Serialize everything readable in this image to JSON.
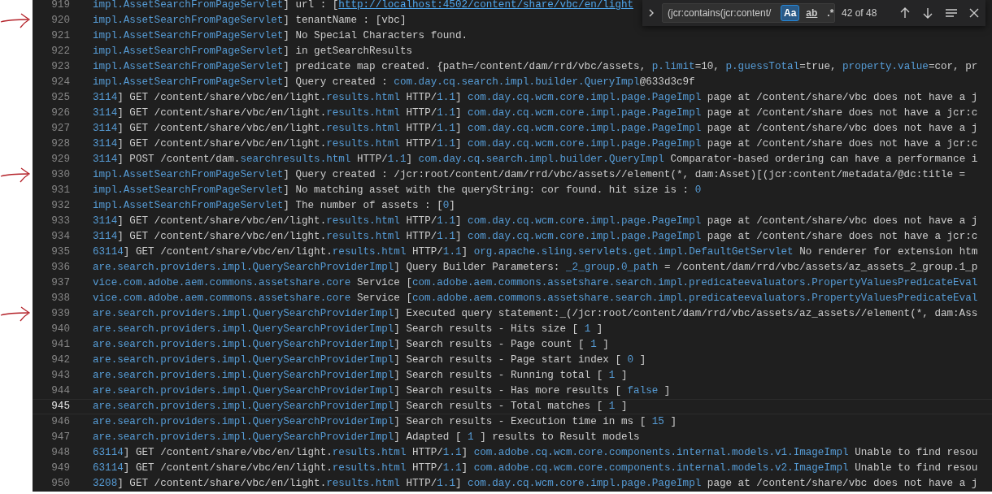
{
  "find_widget": {
    "query": "(jcr:contains(jcr:content/",
    "options": [
      {
        "label": "Aa",
        "selected": true
      },
      {
        "label": "ab",
        "selected": false
      },
      {
        "label": ".*",
        "selected": false
      }
    ],
    "result": "42 of 48"
  },
  "lines": [
    {
      "number": "919",
      "marked": false,
      "current": false,
      "segments": [
        {
          "text": "impl.AssetSearchFromPageServlet",
          "kind": "token"
        },
        {
          "text": "] url : [",
          "kind": "plain"
        },
        {
          "text": "http://localhost:4502/content/share/vbc/en/light",
          "kind": "link"
        }
      ]
    },
    {
      "number": "920",
      "marked": true,
      "current": false,
      "segments": [
        {
          "text": "impl.AssetSearchFromPageServlet",
          "kind": "token"
        },
        {
          "text": "] tenantName : [vbc]",
          "kind": "plain"
        }
      ]
    },
    {
      "number": "921",
      "marked": false,
      "current": false,
      "segments": [
        {
          "text": "impl.AssetSearchFromPageServlet",
          "kind": "token"
        },
        {
          "text": "] No Special Characters found.",
          "kind": "plain"
        }
      ]
    },
    {
      "number": "922",
      "marked": false,
      "current": false,
      "segments": [
        {
          "text": "impl.AssetSearchFromPageServlet",
          "kind": "token"
        },
        {
          "text": "] in getSearchResults",
          "kind": "plain"
        }
      ]
    },
    {
      "number": "923",
      "marked": false,
      "current": false,
      "segments": [
        {
          "text": "impl.AssetSearchFromPageServlet",
          "kind": "token"
        },
        {
          "text": "] predicate map created. {path=/content/dam/rrd/vbc/assets, ",
          "kind": "plain"
        },
        {
          "text": "p.limit",
          "kind": "token"
        },
        {
          "text": "=10, ",
          "kind": "plain"
        },
        {
          "text": "p.guessTotal",
          "kind": "token"
        },
        {
          "text": "=true, ",
          "kind": "plain"
        },
        {
          "text": "property.value",
          "kind": "token"
        },
        {
          "text": "=cor, pr",
          "kind": "plain"
        }
      ]
    },
    {
      "number": "924",
      "marked": false,
      "current": false,
      "segments": [
        {
          "text": "impl.AssetSearchFromPageServlet",
          "kind": "token"
        },
        {
          "text": "] Query created : ",
          "kind": "plain"
        },
        {
          "text": "com.day.cq.search.impl.builder.QueryImpl",
          "kind": "token"
        },
        {
          "text": "@633d3c9f",
          "kind": "plain"
        }
      ]
    },
    {
      "number": "925",
      "marked": false,
      "current": false,
      "segments": [
        {
          "text": "3114",
          "kind": "token"
        },
        {
          "text": "] GET /content/share/vbc/en/light.",
          "kind": "plain"
        },
        {
          "text": "results.html",
          "kind": "token"
        },
        {
          "text": " HTTP/",
          "kind": "plain"
        },
        {
          "text": "1.1",
          "kind": "token"
        },
        {
          "text": "] ",
          "kind": "plain"
        },
        {
          "text": "com.day.cq.wcm.core.impl.page.PageImpl",
          "kind": "token"
        },
        {
          "text": " page at /content/share/vbc does not have a j",
          "kind": "plain"
        }
      ]
    },
    {
      "number": "926",
      "marked": false,
      "current": false,
      "segments": [
        {
          "text": "3114",
          "kind": "token"
        },
        {
          "text": "] GET /content/share/vbc/en/light.",
          "kind": "plain"
        },
        {
          "text": "results.html",
          "kind": "token"
        },
        {
          "text": " HTTP/",
          "kind": "plain"
        },
        {
          "text": "1.1",
          "kind": "token"
        },
        {
          "text": "] ",
          "kind": "plain"
        },
        {
          "text": "com.day.cq.wcm.core.impl.page.PageImpl",
          "kind": "token"
        },
        {
          "text": " page at /content/share does not have a jcr:c",
          "kind": "plain"
        }
      ]
    },
    {
      "number": "927",
      "marked": false,
      "current": false,
      "segments": [
        {
          "text": "3114",
          "kind": "token"
        },
        {
          "text": "] GET /content/share/vbc/en/light.",
          "kind": "plain"
        },
        {
          "text": "results.html",
          "kind": "token"
        },
        {
          "text": " HTTP/",
          "kind": "plain"
        },
        {
          "text": "1.1",
          "kind": "token"
        },
        {
          "text": "] ",
          "kind": "plain"
        },
        {
          "text": "com.day.cq.wcm.core.impl.page.PageImpl",
          "kind": "token"
        },
        {
          "text": " page at /content/share/vbc does not have a j",
          "kind": "plain"
        }
      ]
    },
    {
      "number": "928",
      "marked": false,
      "current": false,
      "segments": [
        {
          "text": "3114",
          "kind": "token"
        },
        {
          "text": "] GET /content/share/vbc/en/light.",
          "kind": "plain"
        },
        {
          "text": "results.html",
          "kind": "token"
        },
        {
          "text": " HTTP/",
          "kind": "plain"
        },
        {
          "text": "1.1",
          "kind": "token"
        },
        {
          "text": "] ",
          "kind": "plain"
        },
        {
          "text": "com.day.cq.wcm.core.impl.page.PageImpl",
          "kind": "token"
        },
        {
          "text": " page at /content/share does not have a jcr:c",
          "kind": "plain"
        }
      ]
    },
    {
      "number": "929",
      "marked": false,
      "current": false,
      "segments": [
        {
          "text": "3114",
          "kind": "token"
        },
        {
          "text": "] POST /content/dam.",
          "kind": "plain"
        },
        {
          "text": "searchresults.html",
          "kind": "token"
        },
        {
          "text": " HTTP/",
          "kind": "plain"
        },
        {
          "text": "1.1",
          "kind": "token"
        },
        {
          "text": "] ",
          "kind": "plain"
        },
        {
          "text": "com.day.cq.search.impl.builder.QueryImpl",
          "kind": "token"
        },
        {
          "text": " Comparator-based ordering can have a performance i",
          "kind": "plain"
        }
      ]
    },
    {
      "number": "930",
      "marked": true,
      "current": false,
      "segments": [
        {
          "text": "impl.AssetSearchFromPageServlet",
          "kind": "token"
        },
        {
          "text": "] Query created : /jcr:root/content/dam/rrd/vbc/assets//element(*, dam:Asset)[(jcr:content/metadata/@dc:title =",
          "kind": "plain"
        }
      ]
    },
    {
      "number": "931",
      "marked": false,
      "current": false,
      "segments": [
        {
          "text": "impl.AssetSearchFromPageServlet",
          "kind": "token"
        },
        {
          "text": "] No matching asset with the queryString: cor found. hit size is : ",
          "kind": "plain"
        },
        {
          "text": "0",
          "kind": "token"
        }
      ]
    },
    {
      "number": "932",
      "marked": false,
      "current": false,
      "segments": [
        {
          "text": "impl.AssetSearchFromPageServlet",
          "kind": "token"
        },
        {
          "text": "] The number of assets : [",
          "kind": "plain"
        },
        {
          "text": "0",
          "kind": "token"
        },
        {
          "text": "]",
          "kind": "plain"
        }
      ]
    },
    {
      "number": "933",
      "marked": false,
      "current": false,
      "segments": [
        {
          "text": "3114",
          "kind": "token"
        },
        {
          "text": "] GET /content/share/vbc/en/light.",
          "kind": "plain"
        },
        {
          "text": "results.html",
          "kind": "token"
        },
        {
          "text": " HTTP/",
          "kind": "plain"
        },
        {
          "text": "1.1",
          "kind": "token"
        },
        {
          "text": "] ",
          "kind": "plain"
        },
        {
          "text": "com.day.cq.wcm.core.impl.page.PageImpl",
          "kind": "token"
        },
        {
          "text": " page at /content/share/vbc does not have a j",
          "kind": "plain"
        }
      ]
    },
    {
      "number": "934",
      "marked": false,
      "current": false,
      "segments": [
        {
          "text": "3114",
          "kind": "token"
        },
        {
          "text": "] GET /content/share/vbc/en/light.",
          "kind": "plain"
        },
        {
          "text": "results.html",
          "kind": "token"
        },
        {
          "text": " HTTP/",
          "kind": "plain"
        },
        {
          "text": "1.1",
          "kind": "token"
        },
        {
          "text": "] ",
          "kind": "plain"
        },
        {
          "text": "com.day.cq.wcm.core.impl.page.PageImpl",
          "kind": "token"
        },
        {
          "text": " page at /content/share does not have a jcr:c",
          "kind": "plain"
        }
      ]
    },
    {
      "number": "935",
      "marked": false,
      "current": false,
      "segments": [
        {
          "text": "63114",
          "kind": "token"
        },
        {
          "text": "] GET /content/share/vbc/en/light.",
          "kind": "plain"
        },
        {
          "text": "results.html",
          "kind": "token"
        },
        {
          "text": " HTTP/",
          "kind": "plain"
        },
        {
          "text": "1.1",
          "kind": "token"
        },
        {
          "text": "] ",
          "kind": "plain"
        },
        {
          "text": "org.apache.sling.servlets.get.impl.DefaultGetServlet",
          "kind": "token"
        },
        {
          "text": " No renderer for extension htm",
          "kind": "plain"
        }
      ]
    },
    {
      "number": "936",
      "marked": false,
      "current": false,
      "segments": [
        {
          "text": "are.search.providers.impl.QuerySearchProviderImpl",
          "kind": "token"
        },
        {
          "text": "] Query Builder Parameters: ",
          "kind": "plain"
        },
        {
          "text": "_2_group.0_path",
          "kind": "token"
        },
        {
          "text": " = /content/dam/rrd/vbc/assets/az_assets_2_group.1_p",
          "kind": "plain"
        }
      ]
    },
    {
      "number": "937",
      "marked": false,
      "current": false,
      "segments": [
        {
          "text": "vice.com.adobe.aem.commons.assetshare.core",
          "kind": "token"
        },
        {
          "text": " Service [",
          "kind": "plain"
        },
        {
          "text": "com.adobe.aem.commons.assetshare.search.impl.predicateevaluators.PropertyValuesPredicateEval",
          "kind": "token"
        }
      ]
    },
    {
      "number": "938",
      "marked": false,
      "current": false,
      "segments": [
        {
          "text": "vice.com.adobe.aem.commons.assetshare.core",
          "kind": "token"
        },
        {
          "text": " Service [",
          "kind": "plain"
        },
        {
          "text": "com.adobe.aem.commons.assetshare.search.impl.predicateevaluators.PropertyValuesPredicateEval",
          "kind": "token"
        }
      ]
    },
    {
      "number": "939",
      "marked": true,
      "current": false,
      "segments": [
        {
          "text": "are.search.providers.impl.QuerySearchProviderImpl",
          "kind": "token"
        },
        {
          "text": "] Executed query statement:_(/jcr:root/content/dam/rrd/vbc/assets/az_assets//element(*, dam:Ass",
          "kind": "plain"
        }
      ]
    },
    {
      "number": "940",
      "marked": false,
      "current": false,
      "segments": [
        {
          "text": "are.search.providers.impl.QuerySearchProviderImpl",
          "kind": "token"
        },
        {
          "text": "] Search results - Hits size [ ",
          "kind": "plain"
        },
        {
          "text": "1",
          "kind": "token"
        },
        {
          "text": " ]",
          "kind": "plain"
        }
      ]
    },
    {
      "number": "941",
      "marked": false,
      "current": false,
      "segments": [
        {
          "text": "are.search.providers.impl.QuerySearchProviderImpl",
          "kind": "token"
        },
        {
          "text": "] Search results - Page count [ ",
          "kind": "plain"
        },
        {
          "text": "1",
          "kind": "token"
        },
        {
          "text": " ]",
          "kind": "plain"
        }
      ]
    },
    {
      "number": "942",
      "marked": false,
      "current": false,
      "segments": [
        {
          "text": "are.search.providers.impl.QuerySearchProviderImpl",
          "kind": "token"
        },
        {
          "text": "] Search results - Page start index [ ",
          "kind": "plain"
        },
        {
          "text": "0",
          "kind": "token"
        },
        {
          "text": " ]",
          "kind": "plain"
        }
      ]
    },
    {
      "number": "943",
      "marked": false,
      "current": false,
      "segments": [
        {
          "text": "are.search.providers.impl.QuerySearchProviderImpl",
          "kind": "token"
        },
        {
          "text": "] Search results - Running total [ ",
          "kind": "plain"
        },
        {
          "text": "1",
          "kind": "token"
        },
        {
          "text": " ]",
          "kind": "plain"
        }
      ]
    },
    {
      "number": "944",
      "marked": false,
      "current": false,
      "segments": [
        {
          "text": "are.search.providers.impl.QuerySearchProviderImpl",
          "kind": "token"
        },
        {
          "text": "] Search results - Has more results [ ",
          "kind": "plain"
        },
        {
          "text": "false",
          "kind": "token"
        },
        {
          "text": " ]",
          "kind": "plain"
        }
      ]
    },
    {
      "number": "945",
      "marked": false,
      "current": true,
      "segments": [
        {
          "text": "are.search.providers.impl.QuerySearchProviderImpl",
          "kind": "token"
        },
        {
          "text": "] Search results - Total matches [ ",
          "kind": "plain"
        },
        {
          "text": "1",
          "kind": "token"
        },
        {
          "text": " ]",
          "kind": "plain"
        }
      ]
    },
    {
      "number": "946",
      "marked": false,
      "current": false,
      "segments": [
        {
          "text": "are.search.providers.impl.QuerySearchProviderImpl",
          "kind": "token"
        },
        {
          "text": "] Search results - Execution time in ms [ ",
          "kind": "plain"
        },
        {
          "text": "15",
          "kind": "token"
        },
        {
          "text": " ]",
          "kind": "plain"
        }
      ]
    },
    {
      "number": "947",
      "marked": false,
      "current": false,
      "segments": [
        {
          "text": "are.search.providers.impl.QuerySearchProviderImpl",
          "kind": "token"
        },
        {
          "text": "] Adapted [ ",
          "kind": "plain"
        },
        {
          "text": "1",
          "kind": "token"
        },
        {
          "text": " ] results to Result models",
          "kind": "plain"
        }
      ]
    },
    {
      "number": "948",
      "marked": false,
      "current": false,
      "segments": [
        {
          "text": "63114",
          "kind": "token"
        },
        {
          "text": "] GET /content/share/vbc/en/light.",
          "kind": "plain"
        },
        {
          "text": "results.html",
          "kind": "token"
        },
        {
          "text": " HTTP/",
          "kind": "plain"
        },
        {
          "text": "1.1",
          "kind": "token"
        },
        {
          "text": "] ",
          "kind": "plain"
        },
        {
          "text": "com.adobe.cq.wcm.core.components.internal.models.v1.ImageImpl",
          "kind": "token"
        },
        {
          "text": " Unable to find resou",
          "kind": "plain"
        }
      ]
    },
    {
      "number": "949",
      "marked": false,
      "current": false,
      "segments": [
        {
          "text": "63114",
          "kind": "token"
        },
        {
          "text": "] GET /content/share/vbc/en/light.",
          "kind": "plain"
        },
        {
          "text": "results.html",
          "kind": "token"
        },
        {
          "text": " HTTP/",
          "kind": "plain"
        },
        {
          "text": "1.1",
          "kind": "token"
        },
        {
          "text": "] ",
          "kind": "plain"
        },
        {
          "text": "com.adobe.cq.wcm.core.components.internal.models.v2.ImageImpl",
          "kind": "token"
        },
        {
          "text": " Unable to find resou",
          "kind": "plain"
        }
      ]
    },
    {
      "number": "950",
      "marked": false,
      "current": false,
      "segments": [
        {
          "text": "3208",
          "kind": "token"
        },
        {
          "text": "] GET /content/share/vbc/en/light.",
          "kind": "plain"
        },
        {
          "text": "results.html",
          "kind": "token"
        },
        {
          "text": " HTTP/",
          "kind": "plain"
        },
        {
          "text": "1.1",
          "kind": "token"
        },
        {
          "text": "] ",
          "kind": "plain"
        },
        {
          "text": "com.day.cq.wcm.core.impl.page.PageImpl",
          "kind": "token"
        },
        {
          "text": " page at /content/share/vbc does not have a j",
          "kind": "plain"
        }
      ]
    }
  ]
}
